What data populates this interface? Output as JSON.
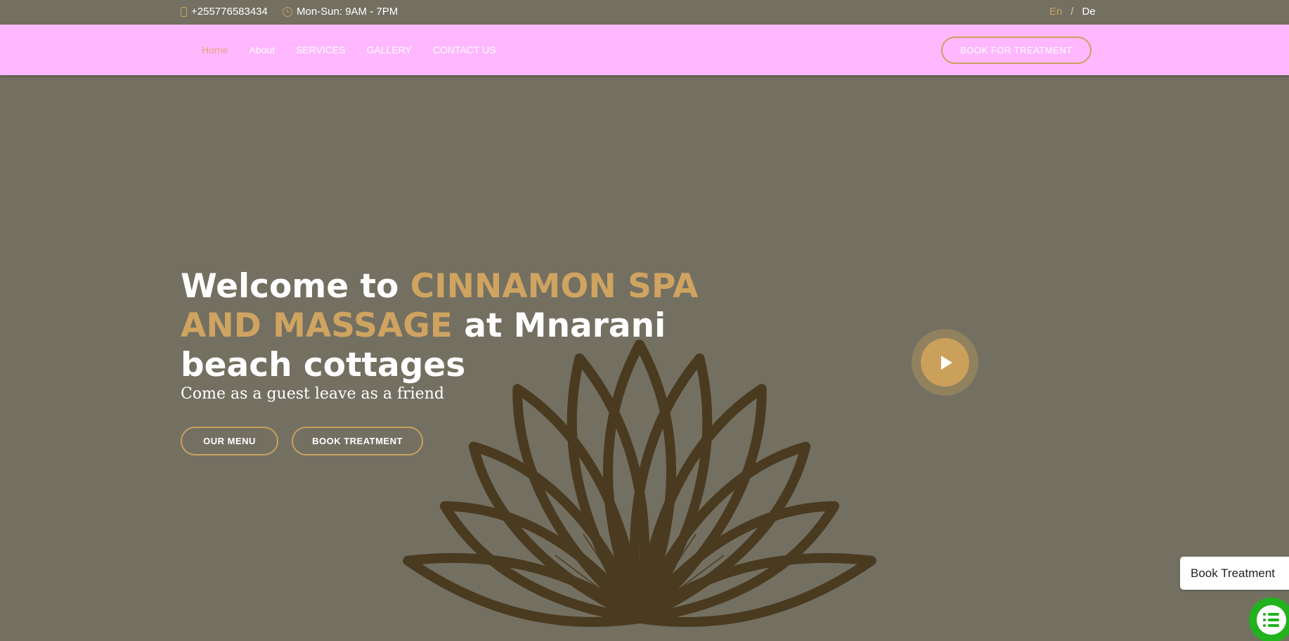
{
  "topbar": {
    "phone": "+255776583434",
    "hours": "Mon-Sun: 9AM - 7PM",
    "lang_en": "En",
    "lang_sep": "/",
    "lang_de": "De"
  },
  "nav": {
    "items": [
      "Home",
      "About",
      "SERVICES",
      "GALLERY",
      "CONTACT US"
    ],
    "active": "Home",
    "book_button": "BOOK FOR TREATMENT"
  },
  "hero": {
    "title_prefix": "Welcome to ",
    "title_accent": "CINNAMON SPA AND MASSAGE",
    "title_suffix": " at Mnarani beach cottages",
    "subtitle": "Come as a guest leave as a friend",
    "menu_button": "OUR MENU",
    "book_button": "BOOK TREATMENT"
  },
  "floating": {
    "book_label": "Book Treatment"
  },
  "colors": {
    "accent": "#c9a05c",
    "nav_bg": "#ffb8ff",
    "page_bg": "#737062",
    "chat": "#21b21d",
    "lotus": "#4a3a20"
  },
  "icons": [
    "phone-icon",
    "clock-icon",
    "play-icon",
    "chat-list-icon",
    "lotus-logo"
  ]
}
